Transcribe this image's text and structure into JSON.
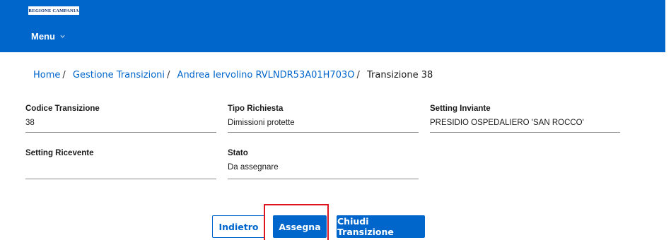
{
  "header": {
    "logo_text": "REGIONE CAMPANIA",
    "menu_label": "Menu",
    "background": "#0066cc"
  },
  "breadcrumb": {
    "items": [
      "Home",
      "Gestione Transizioni",
      "Andrea Iervolino RVLNDR53A01H703O"
    ],
    "current": "Transizione 38",
    "separator": "/"
  },
  "fields": {
    "codice_transizione": {
      "label": "Codice Transizione",
      "value": "38"
    },
    "tipo_richiesta": {
      "label": "Tipo Richiesta",
      "value": "Dimissioni protette"
    },
    "setting_inviante": {
      "label": "Setting Inviante",
      "value": "PRESIDIO OSPEDALIERO 'SAN ROCCO'"
    },
    "setting_ricevente": {
      "label": "Setting Ricevente",
      "value": ""
    },
    "stato": {
      "label": "Stato",
      "value": "Da assegnare"
    }
  },
  "actions": {
    "back_label": "Indietro",
    "assign_label": "Assegna",
    "close_label": "Chiudi Transizione"
  },
  "colors": {
    "accent": "#0066cc",
    "highlight": "#e0141e"
  },
  "icons": {
    "menu_chevron": "chevron-down-icon"
  }
}
